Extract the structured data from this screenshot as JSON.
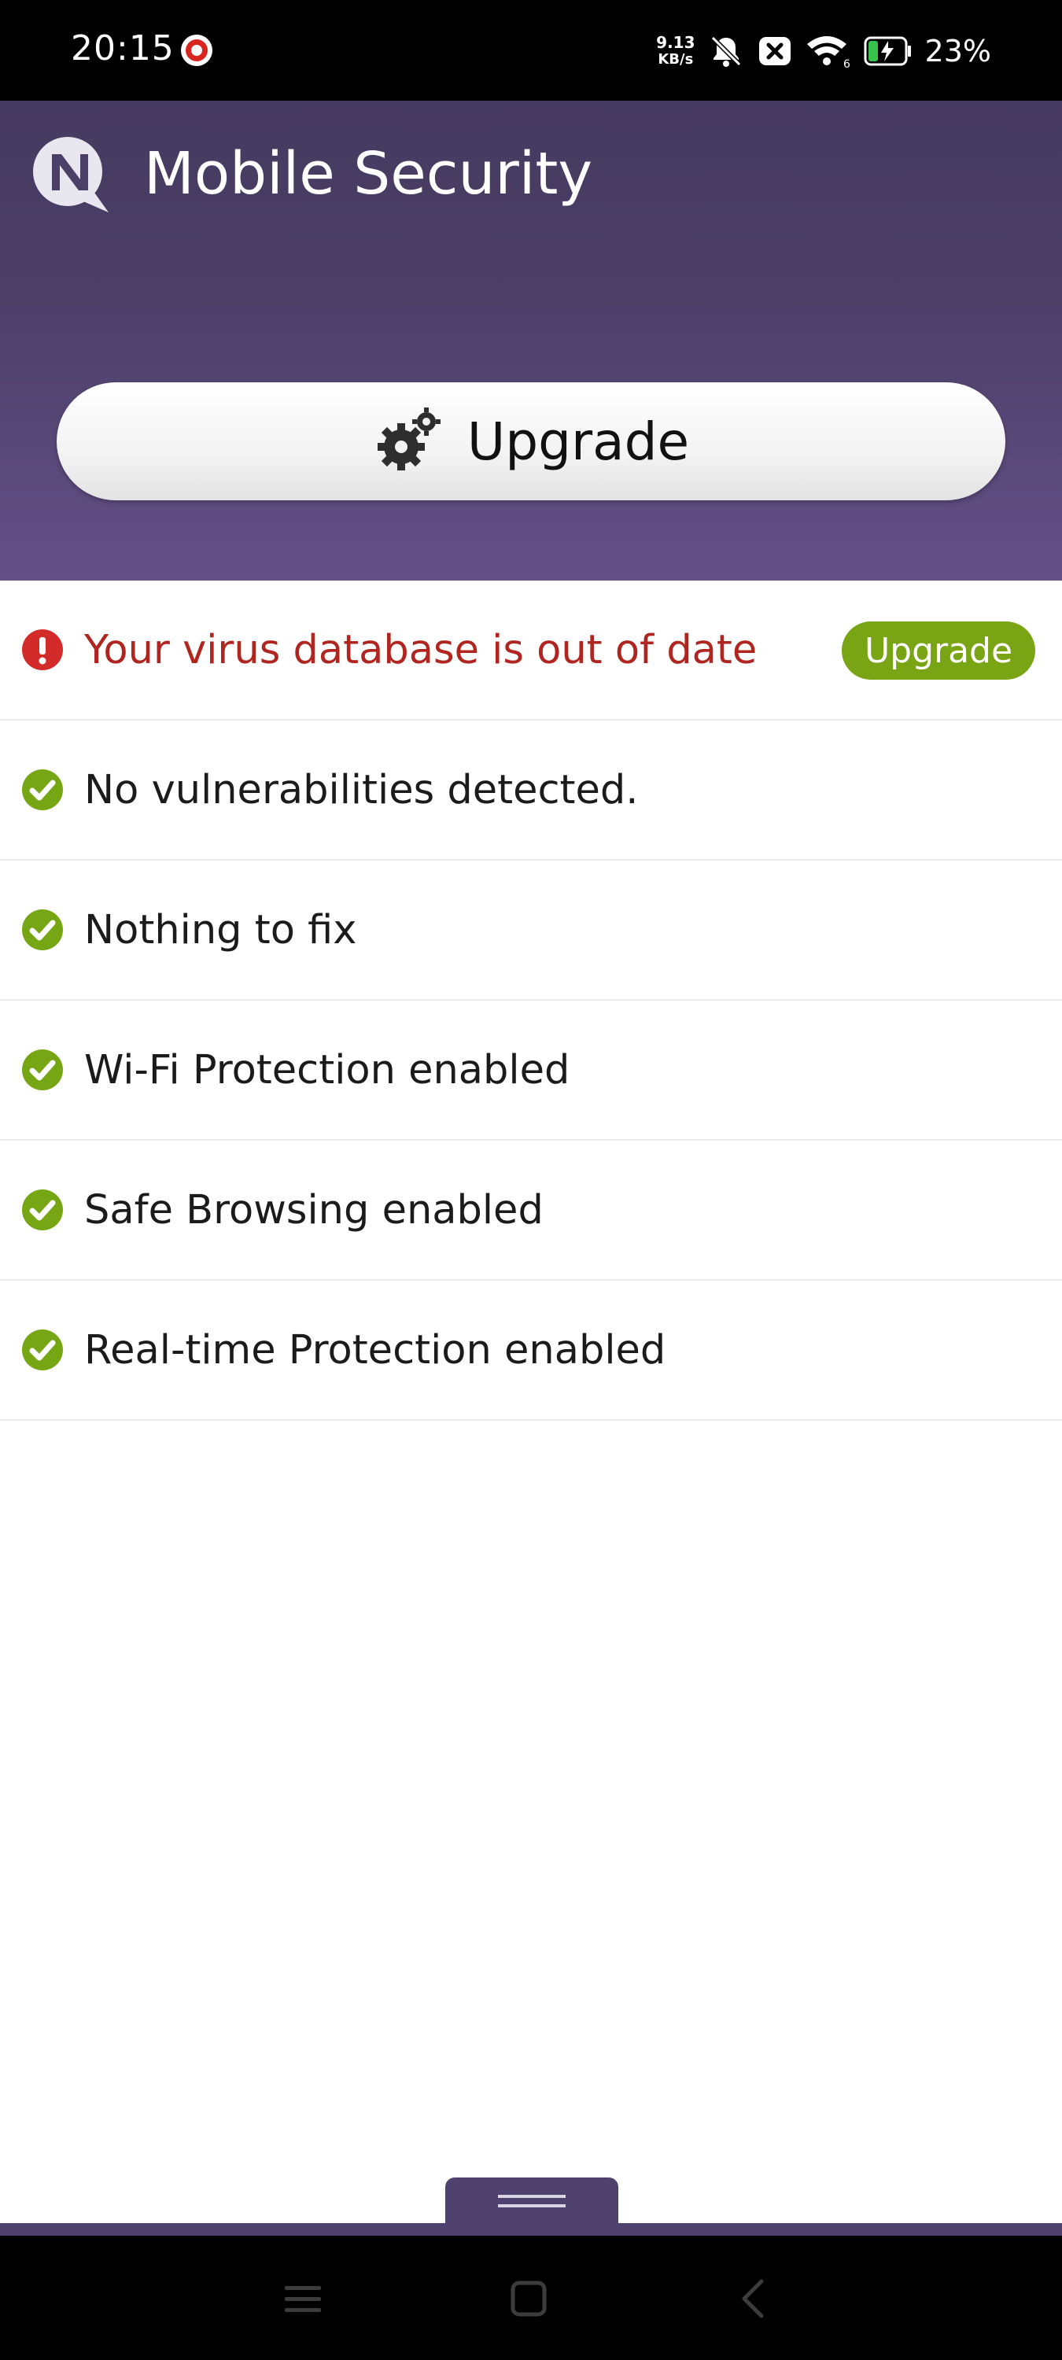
{
  "status_bar": {
    "time": "20:15",
    "net_speed_value": "9.13",
    "net_speed_unit": "KB/s",
    "battery_percent": "23%"
  },
  "header": {
    "title": "Mobile Security",
    "upgrade_button_label": "Upgrade"
  },
  "status_items": [
    {
      "text": "Your virus database is out of date",
      "state": "alert",
      "action_label": "Upgrade"
    },
    {
      "text": "No vulnerabilities detected.",
      "state": "ok"
    },
    {
      "text": "Nothing to fix",
      "state": "ok"
    },
    {
      "text": "Wi-Fi Protection enabled",
      "state": "ok"
    },
    {
      "text": "Safe Browsing enabled",
      "state": "ok"
    },
    {
      "text": "Real-time Protection enabled",
      "state": "ok"
    }
  ],
  "colors": {
    "header_top": "#453a5f",
    "header_bottom": "#645087",
    "alert_text": "#b0251f",
    "ok_icon": "#76a614",
    "upgrade_pill": "#79a514"
  },
  "icons": {
    "logo": "n-speech-bubble-logo",
    "upgrade": "gears-icon",
    "alert": "exclamation-icon",
    "ok": "check-circle-icon"
  }
}
